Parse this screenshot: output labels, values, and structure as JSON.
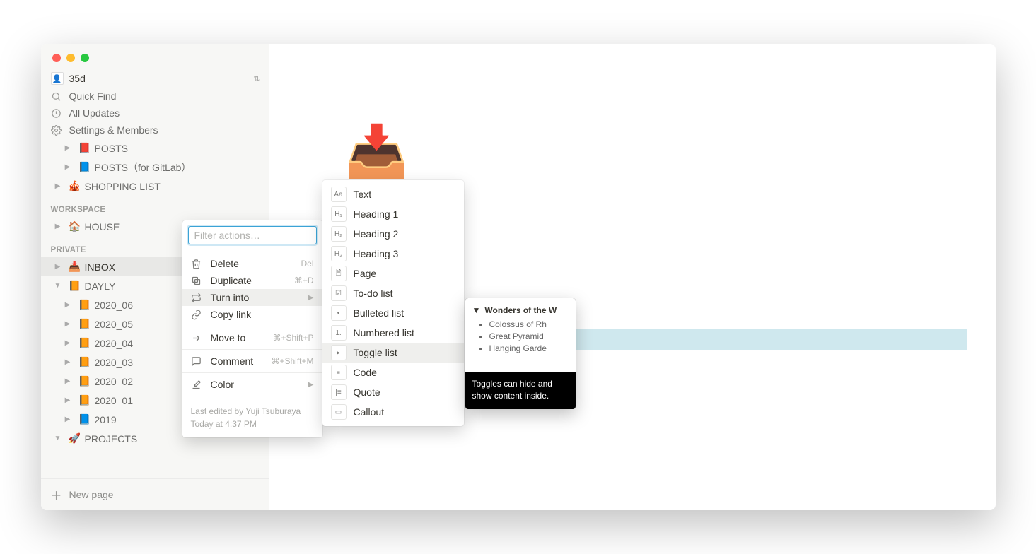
{
  "header": {
    "workspace_name": "35d"
  },
  "sidebar": {
    "quick_find": "Quick Find",
    "all_updates": "All Updates",
    "settings_members": "Settings & Members",
    "top_items": [
      {
        "emoji": "📕",
        "label": "POSTS"
      },
      {
        "emoji": "📘",
        "label": "POSTS（for GitLab）"
      },
      {
        "emoji": "🎪",
        "label": "SHOPPING LIST"
      }
    ],
    "workspace_label": "WORKSPACE",
    "workspace_items": [
      {
        "emoji": "🏠",
        "label": "HOUSE"
      }
    ],
    "private_label": "PRIVATE",
    "private_items": [
      {
        "emoji": "📥",
        "label": "INBOX",
        "active": true
      },
      {
        "emoji": "📙",
        "label": "DAYLY",
        "open": true
      },
      {
        "emoji": "📙",
        "label": "2020_06",
        "indent": 1
      },
      {
        "emoji": "📙",
        "label": "2020_05",
        "indent": 1
      },
      {
        "emoji": "📙",
        "label": "2020_04",
        "indent": 1
      },
      {
        "emoji": "📙",
        "label": "2020_03",
        "indent": 1
      },
      {
        "emoji": "📙",
        "label": "2020_02",
        "indent": 1
      },
      {
        "emoji": "📙",
        "label": "2020_01",
        "indent": 1
      },
      {
        "emoji": "📘",
        "label": "2019",
        "indent": 1
      },
      {
        "emoji": "🚀",
        "label": "PROJECTS",
        "open": true
      }
    ],
    "new_page": "New page"
  },
  "ctx": {
    "filter_placeholder": "Filter actions…",
    "items": {
      "delete": {
        "label": "Delete",
        "kbd": "Del"
      },
      "duplicate": {
        "label": "Duplicate",
        "kbd": "⌘+D"
      },
      "turn_into": {
        "label": "Turn into"
      },
      "copy_link": {
        "label": "Copy link"
      },
      "move_to": {
        "label": "Move to",
        "kbd": "⌘+Shift+P"
      },
      "comment": {
        "label": "Comment",
        "kbd": "⌘+Shift+M"
      },
      "color": {
        "label": "Color"
      }
    },
    "footer_line1": "Last edited by Yuji Tsuburaya",
    "footer_line2": "Today at 4:37 PM"
  },
  "submenu": {
    "items": {
      "text": "Text",
      "h1": "Heading 1",
      "h2": "Heading 2",
      "h3": "Heading 3",
      "page": "Page",
      "todo": "To-do list",
      "bulleted": "Bulleted list",
      "numbered": "Numbered list",
      "toggle": "Toggle list",
      "code": "Code",
      "quote": "Quote",
      "callout": "Callout"
    }
  },
  "preview": {
    "title": "Wonders of the W",
    "bullets": [
      "Colossus of Rh",
      "Great Pyramid",
      "Hanging Garde"
    ],
    "caption": "Toggles can hide and show content inside."
  },
  "page": {
    "icon": "📥"
  }
}
